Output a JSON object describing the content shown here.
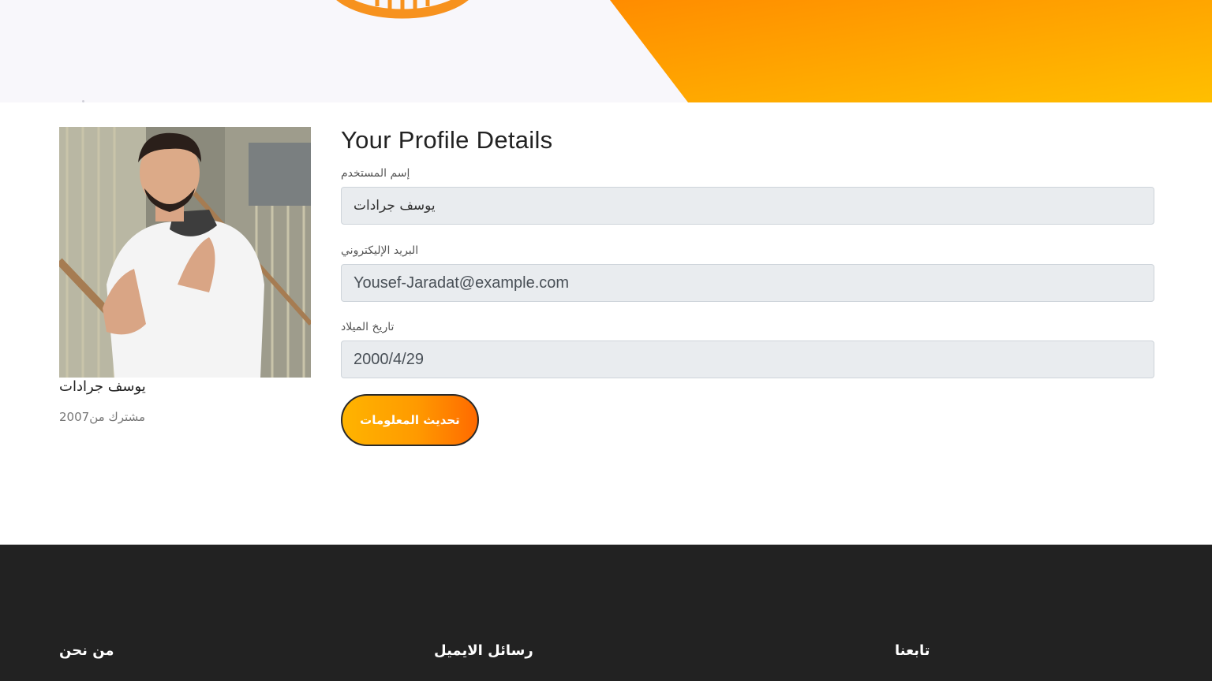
{
  "profile": {
    "name": "يوسف جرادات",
    "member_since_label": "مشترك من",
    "member_since_year": "2007"
  },
  "form": {
    "title": "Your Profile Details",
    "fields": [
      {
        "label": "إسم المستخدم",
        "value": "يوسف جرادات"
      },
      {
        "label": "البريد الإليكتروني",
        "value": "Yousef-Jaradat@example.com"
      },
      {
        "label": "تاريخ الميلاد",
        "value": "2000/4/29"
      }
    ],
    "submit_label": "تحديث المعلومات"
  },
  "footer": {
    "headings": [
      "من نحن",
      "رسائل الايميل",
      "تابعنا"
    ]
  },
  "colors": {
    "accent_start": "#ffb400",
    "accent_end": "#ff6a00",
    "footer_bg": "#222222",
    "input_bg": "#e9ecef"
  },
  "icons": [
    "logo-ring-icon",
    "profile-photo"
  ]
}
